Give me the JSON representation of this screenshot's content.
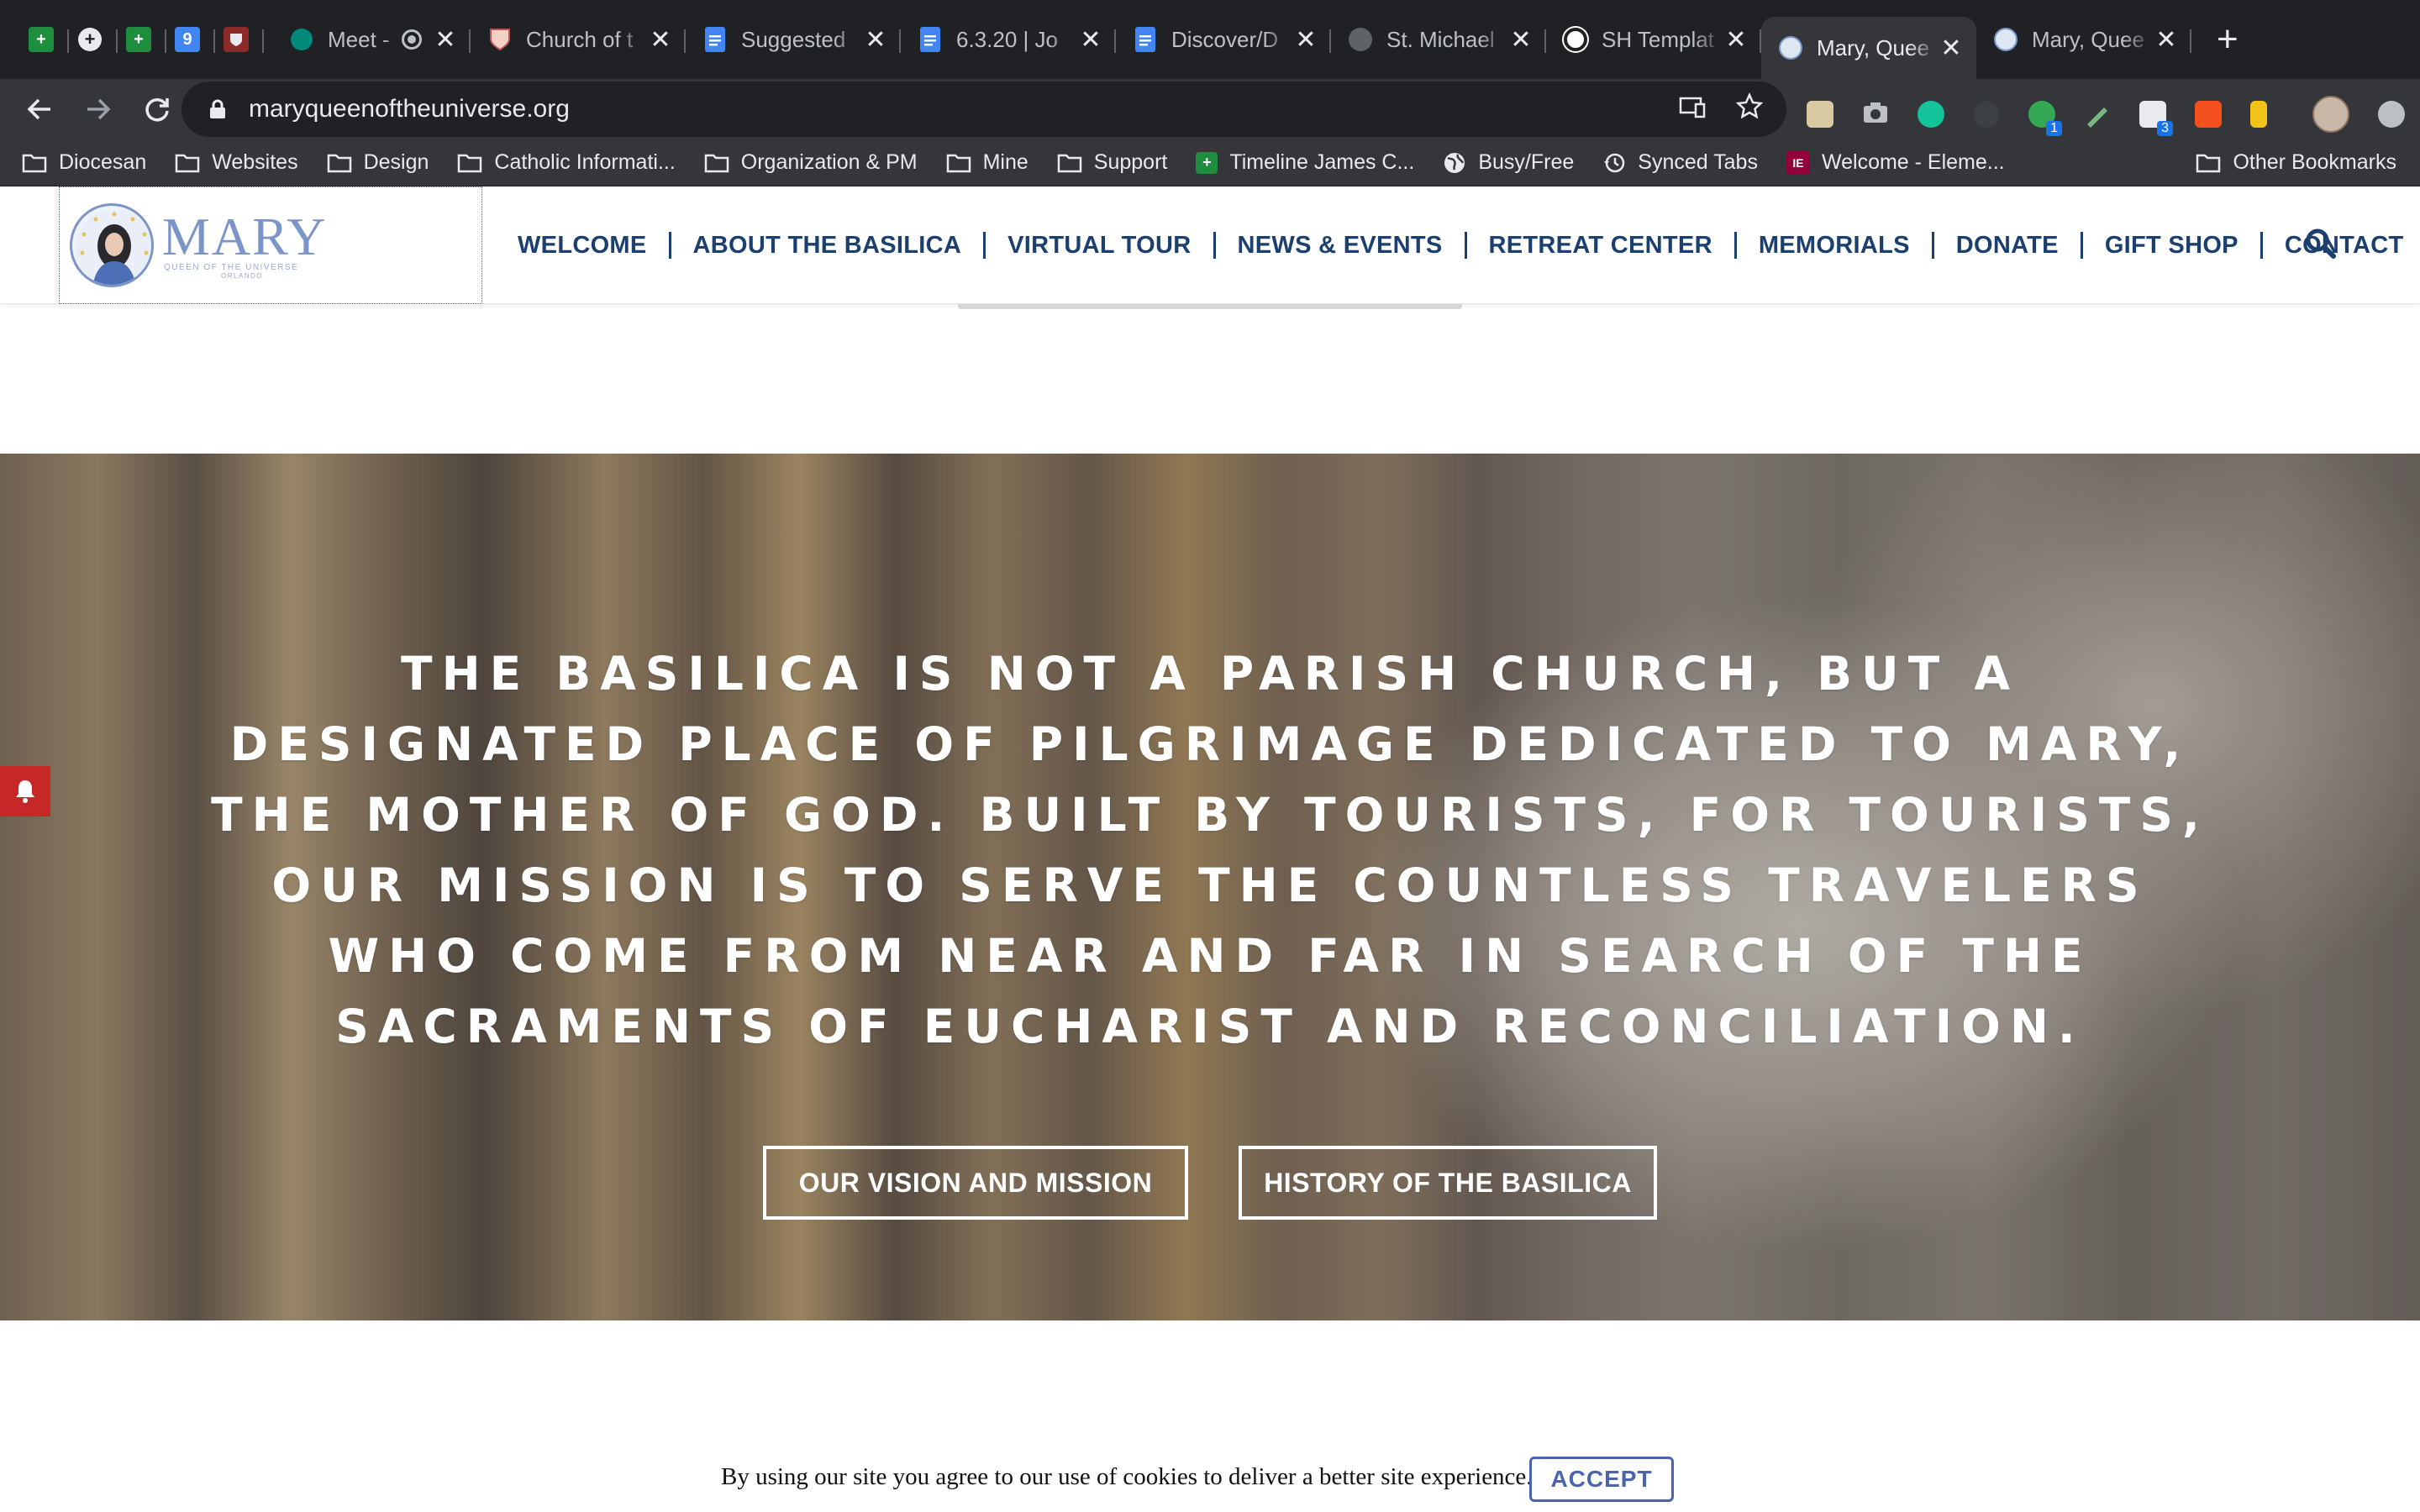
{
  "browser": {
    "pinned_tabs": [
      {
        "icon": "google-sheets-icon"
      },
      {
        "icon": "circle-plus-icon"
      },
      {
        "icon": "google-sheets-icon"
      },
      {
        "icon": "calendar-icon",
        "label": "9"
      },
      {
        "icon": "crest-icon"
      }
    ],
    "tabs": [
      {
        "title": "Meet - ",
        "icon": "google-meet-icon",
        "extra_icon": "record-icon"
      },
      {
        "title": "Church of t",
        "icon": "shield-crest-icon"
      },
      {
        "title": "Suggested",
        "icon": "google-docs-icon"
      },
      {
        "title": "6.3.20 | Jo",
        "icon": "google-docs-icon"
      },
      {
        "title": "Discover/D",
        "icon": "google-docs-icon"
      },
      {
        "title": "St. Michael",
        "icon": "globe-icon"
      },
      {
        "title": "SH Templat",
        "icon": "circle-logo-icon"
      },
      {
        "title": "Mary, Quee",
        "icon": "mary-favicon-icon",
        "active": true
      },
      {
        "title": "Mary, Quee",
        "icon": "mary-favicon-icon"
      }
    ],
    "close_glyph": "✕",
    "new_tab_glyph": "+",
    "url": "maryqueenoftheuniverse.org",
    "extension_badges": [
      "1",
      "3"
    ],
    "bookmarks": [
      {
        "label": "Diocesan",
        "icon": "folder-icon"
      },
      {
        "label": "Websites",
        "icon": "folder-icon"
      },
      {
        "label": "Design",
        "icon": "folder-icon"
      },
      {
        "label": "Catholic Informati...",
        "icon": "folder-icon"
      },
      {
        "label": "Organization & PM",
        "icon": "folder-icon"
      },
      {
        "label": "Mine",
        "icon": "folder-icon"
      },
      {
        "label": "Support",
        "icon": "folder-icon"
      },
      {
        "label": "Timeline James C...",
        "icon": "google-sheets-icon"
      },
      {
        "label": "Busy/Free",
        "icon": "globe-icon"
      },
      {
        "label": "Synced Tabs",
        "icon": "history-icon"
      },
      {
        "label": "Welcome - Eleme...",
        "icon": "elementor-icon"
      }
    ],
    "other_bookmarks": "Other Bookmarks"
  },
  "site": {
    "logo": {
      "word": "MARY",
      "sub": "QUEEN OF THE UNIVERSE",
      "sub2": "ORLANDO"
    },
    "nav": [
      "WELCOME",
      "ABOUT THE BASILICA",
      "VIRTUAL TOUR",
      "NEWS & EVENTS",
      "RETREAT CENTER",
      "MEMORIALS",
      "DONATE",
      "GIFT SHOP",
      "CONTACT"
    ],
    "nav_icon": "search-icon",
    "brand_color": "#1b3f6e",
    "logo_color": "#7c95c9"
  },
  "hero": {
    "quote": "The Basilica is not a parish church, but a designated place of pilgrimage dedicated to Mary, the Mother of God. Built by tourists, for tourists, our mission is to serve the countless travelers who come from near and far in search of the sacraments of Eucharist and Reconciliation.",
    "buttons": [
      "OUR VISION AND MISSION",
      "HISTORY OF THE BASILICA"
    ]
  },
  "notification_tab": {
    "icon": "bell-icon",
    "color": "#c62828"
  },
  "cookie": {
    "text": "By using our site you agree to our use of cookies to deliver a better site experience.",
    "accept": "ACCEPT",
    "accent": "#4a64b0"
  }
}
